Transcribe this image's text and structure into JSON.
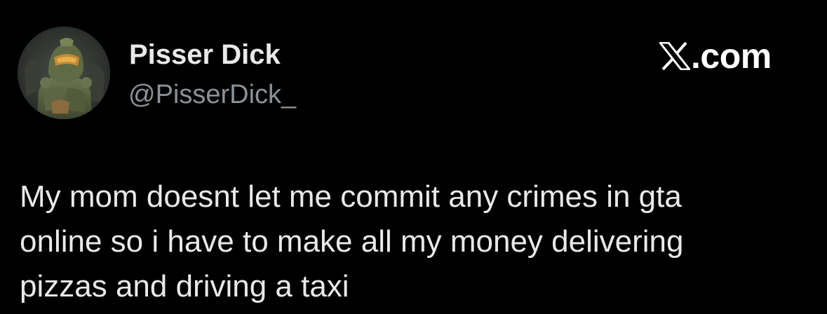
{
  "author": {
    "display_name": "Pisser Dick",
    "handle": "@PisserDick_",
    "avatar_icon": "armored-soldier-avatar"
  },
  "brand": {
    "logo_icon": "x-logo-icon",
    "text": ".com"
  },
  "tweet": {
    "lines": [
      "My mom doesnt let me commit any crimes in gta",
      "online so i have to make all my money delivering",
      "pizzas and driving a taxi"
    ]
  },
  "colors": {
    "background": "#000000",
    "primary_text": "#e7e9ea",
    "secondary_text": "#8b9196",
    "brand": "#ffffff"
  }
}
